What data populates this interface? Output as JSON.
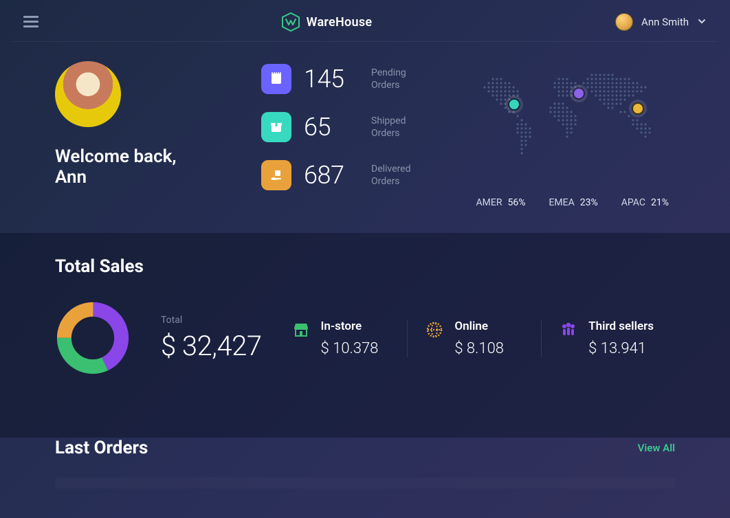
{
  "brand": {
    "name": "WareHouse"
  },
  "user": {
    "name": "Ann Smith"
  },
  "welcome": {
    "line1": "Welcome back,",
    "line2": "Ann"
  },
  "stats": [
    {
      "value": "145",
      "label1": "Pending",
      "label2": "Orders",
      "color": "#6b63ff",
      "icon": "note"
    },
    {
      "value": "65",
      "label1": "Shipped",
      "label2": "Orders",
      "color": "#38d9c1",
      "icon": "box"
    },
    {
      "value": "687",
      "label1": "Delivered",
      "label2": "Orders",
      "color": "#e9a23b",
      "icon": "hand-box"
    }
  ],
  "regions": [
    {
      "name": "AMER",
      "pct": "56%",
      "color": "#39d4bd"
    },
    {
      "name": "EMEA",
      "pct": "23%",
      "color": "#8a63e6"
    },
    {
      "name": "APAC",
      "pct": "21%",
      "color": "#e9b83b"
    }
  ],
  "sales": {
    "title": "Total Sales",
    "total_label": "Total",
    "total_amount": "$ 32,427",
    "channels": [
      {
        "name": "In-store",
        "value": "$ 10.378",
        "color": "#3bbf71",
        "icon": "store"
      },
      {
        "name": "Online",
        "value": "$ 8.108",
        "color": "#e9a23b",
        "icon": "globe"
      },
      {
        "name": "Third sellers",
        "value": "$ 13.941",
        "color": "#8a46e8",
        "icon": "people"
      }
    ]
  },
  "orders": {
    "title": "Last Orders",
    "view_all": "View All"
  },
  "chart_data": {
    "type": "pie",
    "title": "Total Sales",
    "series": [
      {
        "name": "In-store",
        "value": 10378,
        "color": "#3bbf71"
      },
      {
        "name": "Online",
        "value": 8108,
        "color": "#e9a23b"
      },
      {
        "name": "Third sellers",
        "value": 13941,
        "color": "#8a46e8"
      }
    ],
    "total": 32427,
    "donut": true
  }
}
